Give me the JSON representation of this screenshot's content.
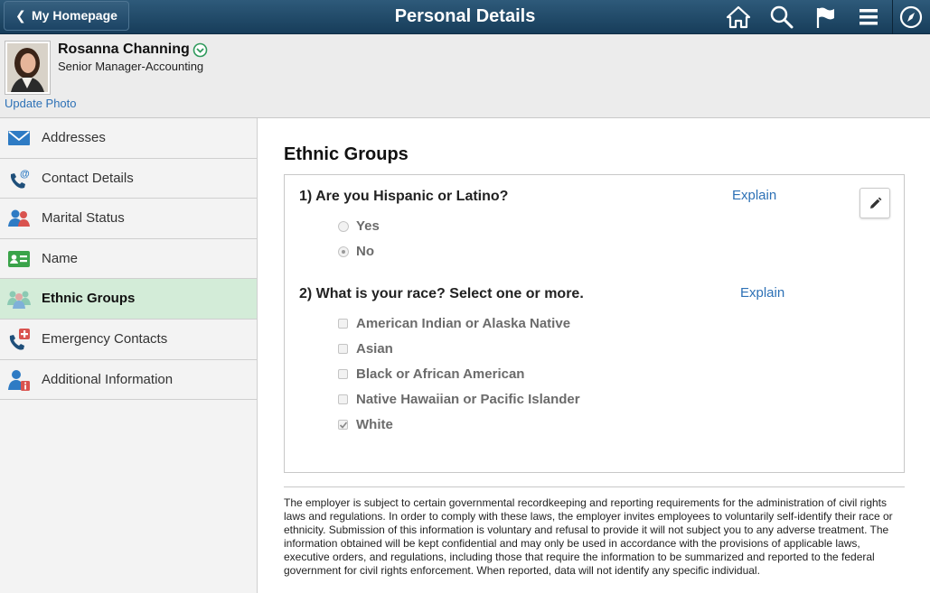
{
  "header": {
    "back_label": "My Homepage",
    "title": "Personal Details",
    "icons": [
      "home-icon",
      "search-icon",
      "flag-icon",
      "menu-icon",
      "compass-icon"
    ]
  },
  "employee": {
    "name": "Rosanna Channing",
    "title": "Senior Manager-Accounting",
    "update_photo": "Update Photo"
  },
  "sidebar": {
    "items": [
      {
        "label": "Addresses",
        "icon": "envelope-icon"
      },
      {
        "label": "Contact Details",
        "icon": "phone-at-icon"
      },
      {
        "label": "Marital Status",
        "icon": "people-icon"
      },
      {
        "label": "Name",
        "icon": "id-card-icon"
      },
      {
        "label": "Ethnic Groups",
        "icon": "group-icon",
        "active": true
      },
      {
        "label": "Emergency Contacts",
        "icon": "phone-plus-icon"
      },
      {
        "label": "Additional Information",
        "icon": "person-info-icon"
      }
    ]
  },
  "main": {
    "section_title": "Ethnic Groups",
    "q1": {
      "text": "1) Are you Hispanic or Latino?",
      "explain": "Explain",
      "options": [
        {
          "label": "Yes",
          "selected": false
        },
        {
          "label": "No",
          "selected": true
        }
      ]
    },
    "q2": {
      "text": "2) What is your race? Select one or more.",
      "explain": "Explain",
      "options": [
        {
          "label": "American Indian or Alaska Native",
          "checked": false
        },
        {
          "label": "Asian",
          "checked": false
        },
        {
          "label": "Black or African American",
          "checked": false
        },
        {
          "label": "Native Hawaiian or Pacific Islander",
          "checked": false
        },
        {
          "label": "White",
          "checked": true
        }
      ]
    },
    "disclaimer": "The employer is subject to certain governmental recordkeeping and reporting requirements for the administration of civil rights laws and regulations. In order to comply with these laws, the employer invites employees to voluntarily self-identify their race or ethnicity. Submission of this information is voluntary and refusal to provide it will not subject you to any adverse treatment. The information obtained will be kept confidential and may only be used in accordance with the provisions of applicable laws, executive orders, and regulations, including those that require the information to be summarized and reported to the federal government for civil rights enforcement. When reported, data will not identify any specific individual."
  },
  "colors": {
    "header_bg": "#1f4768",
    "link": "#2d71b6",
    "active_nav": "#d3ecd8"
  }
}
